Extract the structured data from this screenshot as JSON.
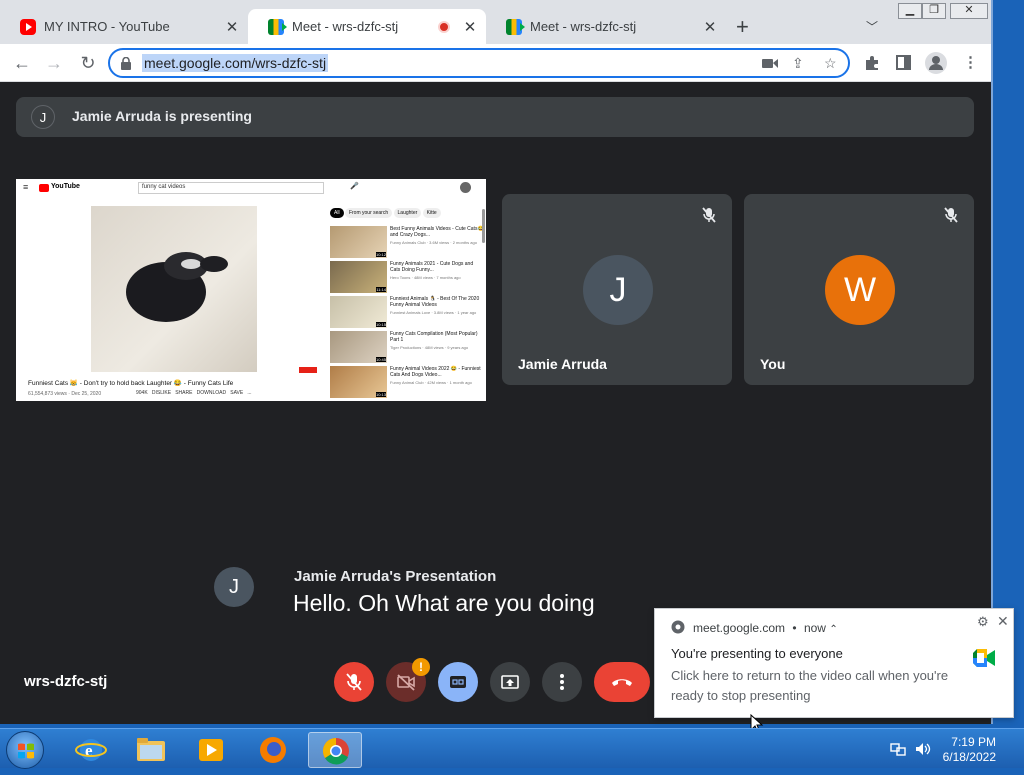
{
  "browser": {
    "tabs": [
      {
        "title": "MY INTRO - YouTube",
        "favicon": "youtube-icon"
      },
      {
        "title": "Meet - wrs-dzfc-stj",
        "favicon": "meet-icon",
        "recording": true
      },
      {
        "title": "Meet - wrs-dzfc-stj",
        "favicon": "meet-icon"
      }
    ],
    "address": "meet.google.com/wrs-dzfc-stj"
  },
  "meet": {
    "banner": {
      "initial": "J",
      "text": "Jamie Arruda is presenting"
    },
    "participants": [
      {
        "initial": "J",
        "name": "Jamie Arruda",
        "avatar_color": "#4a5560",
        "muted": true
      },
      {
        "initial": "W",
        "name": "You",
        "avatar_color": "#e8710a",
        "muted": true
      }
    ],
    "caption": {
      "initial": "J",
      "speaker": "Jamie Arruda's Presentation",
      "text": "Hello. Oh What are you doing"
    },
    "meeting_code": "wrs-dzfc-stj",
    "controls": {
      "camera_alert": "!"
    }
  },
  "shared_screen": {
    "search_query": "funny cat videos",
    "chips": [
      "All",
      "From your search",
      "Laughter",
      "Kitte"
    ],
    "video_title": "Funniest Cats 😹 - Don't try to hold back Laughter 😂 - Funny Cats Life",
    "video_meta": "61,554,873 views · Dec 25, 2020",
    "video_actions": [
      "904K",
      "DISLIKE",
      "SHARE",
      "DOWNLOAD",
      "SAVE",
      "..."
    ],
    "recommendations": [
      {
        "title": "Best Funny Animals Videos - Cute Cats😂 and Crazy Dogs...",
        "meta": "Funny Animals Club · 3.6M views · 2 months ago",
        "dur": "10:12"
      },
      {
        "title": "Funny Animals 2021 - Cute Dogs and Cats Doing Funny...",
        "meta": "Hero Toons · 48M views · 7 months ago",
        "dur": "11:14"
      },
      {
        "title": "Funniest Animals 🐧 - Best Of The 2020 Funny Animal Videos",
        "meta": "Funniest Animals Love · 3.8M views · 1 year ago",
        "dur": "10:15"
      },
      {
        "title": "Funny Cats Compilation (Most Popular) Part 1",
        "meta": "Tiger Productions · 48M views · 9 years ago",
        "dur": "10:45"
      },
      {
        "title": "Funny Animal Videos 2022 😂 - Funniest Cats And Dogs Video...",
        "meta": "Funny Animal Club · 42M views · 1 month ago",
        "dur": "10:13"
      }
    ]
  },
  "notification": {
    "source": "meet.google.com",
    "time": "now",
    "title": "You're presenting to everyone",
    "body": "Click here to return to the video call when you're ready to stop presenting"
  },
  "taskbar": {
    "time": "7:19 PM",
    "date": "6/18/2022"
  }
}
